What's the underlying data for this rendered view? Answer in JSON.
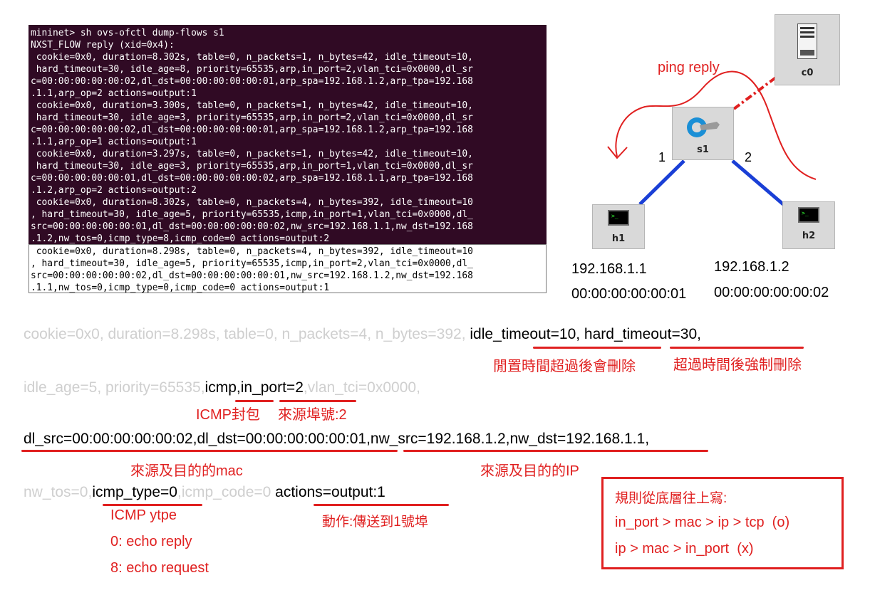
{
  "terminal": {
    "lines": [
      "mininet> sh ovs-ofctl dump-flows s1",
      "NXST_FLOW reply (xid=0x4):",
      " cookie=0x0, duration=8.302s, table=0, n_packets=1, n_bytes=42, idle_timeout=10,",
      " hard_timeout=30, idle_age=8, priority=65535,arp,in_port=2,vlan_tci=0x0000,dl_sr",
      "c=00:00:00:00:00:02,dl_dst=00:00:00:00:00:01,arp_spa=192.168.1.2,arp_tpa=192.168",
      ".1.1,arp_op=2 actions=output:1",
      " cookie=0x0, duration=3.300s, table=0, n_packets=1, n_bytes=42, idle_timeout=10,",
      " hard_timeout=30, idle_age=3, priority=65535,arp,in_port=2,vlan_tci=0x0000,dl_sr",
      "c=00:00:00:00:00:02,dl_dst=00:00:00:00:00:01,arp_spa=192.168.1.2,arp_tpa=192.168",
      ".1.1,arp_op=1 actions=output:1",
      " cookie=0x0, duration=3.297s, table=0, n_packets=1, n_bytes=42, idle_timeout=10,",
      " hard_timeout=30, idle_age=3, priority=65535,arp,in_port=1,vlan_tci=0x0000,dl_sr",
      "c=00:00:00:00:00:01,dl_dst=00:00:00:00:00:02,arp_spa=192.168.1.1,arp_tpa=192.168",
      ".1.2,arp_op=2 actions=output:2",
      " cookie=0x0, duration=8.302s, table=0, n_packets=4, n_bytes=392, idle_timeout=10",
      ", hard_timeout=30, idle_age=5, priority=65535,icmp,in_port=1,vlan_tci=0x0000,dl_",
      "src=00:00:00:00:00:01,dl_dst=00:00:00:00:00:02,nw_src=192.168.1.1,nw_dst=192.168",
      ".1.2,nw_tos=0,icmp_type=8,icmp_code=0 actions=output:2"
    ],
    "highlighted_lines": [
      " cookie=0x0, duration=8.298s, table=0, n_packets=4, n_bytes=392, idle_timeout=10",
      ", hard_timeout=30, idle_age=5, priority=65535,icmp,in_port=2,vlan_tci=0x0000,dl_",
      "src=00:00:00:00:00:02,dl_dst=00:00:00:00:00:01,nw_src=192.168.1.2,nw_dst=192.168",
      ".1.1,nw_tos=0,icmp_type=0,icmp_code=0 actions=output:1"
    ]
  },
  "topology": {
    "controller_label": "c0",
    "switch_label": "s1",
    "h1_label": "h1",
    "h2_label": "h2",
    "port1": "1",
    "port2": "2",
    "ping_label": "ping reply",
    "h1_ip": "192.168.1.1",
    "h1_mac": "00:00:00:00:00:01",
    "h2_ip": "192.168.1.2",
    "h2_mac": "00:00:00:00:00:02",
    "link_color": "#1a3fd6",
    "control_link_color": "#e02020"
  },
  "breakdown": {
    "line1_gray": "cookie=0x0, duration=8.298s, table=0, n_packets=4, n_bytes=392, ",
    "idle_timeout": "idle_timeout=10",
    "comma1": ", ",
    "hard_timeout": "hard_timeout=30",
    "comma2": ",",
    "ann_idle": "閒置時間超過後會刪除",
    "ann_hard": "超過時間後強制刪除",
    "line2_gray": "idle_age=5, priority=65535,",
    "icmp": "icmp",
    "comma3": ",",
    "in_port": "in_port=2",
    "line2_gray_end": ",vlan_tci=0x0000,",
    "ann_icmp": "ICMP封包",
    "ann_port": "來源埠號:2",
    "dl_part": "dl_src=00:00:00:00:00:02,dl_dst=00:00:00:00:00:01",
    "comma4": ",",
    "nw_part": "nw_src=192.168.1.2,nw_dst=192.168.1.1",
    "comma5": ",",
    "ann_mac": "來源及目的的mac",
    "ann_ip": "來源及目的的IP",
    "line4_gray": "nw_tos=0,",
    "icmp_type": "icmp_type=0",
    "line4_gray_mid": ",icmp_code=0 ",
    "actions": "actions=output:1",
    "ann_type_title": "ICMP ytpe",
    "ann_type_0": "0: echo reply",
    "ann_type_8": "8: echo request",
    "ann_action": "動作:傳送到1號埠",
    "rules": [
      "規則從底層往上寫:",
      "in_port > mac > ip > tcp  (o)",
      "ip > mac > in_port  (x)"
    ]
  },
  "colors": {
    "terminal_bg": "#300a24",
    "annotation_red": "#e02020",
    "gray_text": "#cfcfcf"
  }
}
